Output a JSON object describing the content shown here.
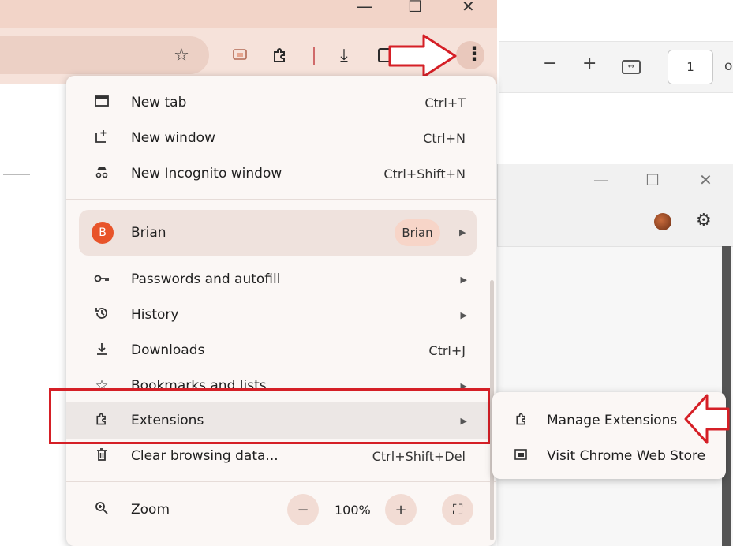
{
  "window": {
    "minimize": "—",
    "maximize": "☐",
    "close": "✕"
  },
  "toolbar": {
    "star": "☆",
    "download": "⤓",
    "menu_dots": "⋮"
  },
  "pdf": {
    "zoom_out": "−",
    "zoom_in": "+",
    "fit": "↔",
    "page": "1",
    "partial": "o"
  },
  "second_window": {
    "minimize": "—",
    "maximize": "☐",
    "close": "✕",
    "settings": "⚙"
  },
  "menu": {
    "new_tab": {
      "label": "New tab",
      "shortcut": "Ctrl+T"
    },
    "new_window": {
      "label": "New window",
      "shortcut": "Ctrl+N"
    },
    "incognito": {
      "label": "New Incognito window",
      "shortcut": "Ctrl+Shift+N"
    },
    "profile": {
      "initial": "B",
      "name": "Brian",
      "chip": "Brian"
    },
    "passwords": {
      "label": "Passwords and autofill"
    },
    "history": {
      "label": "History"
    },
    "downloads": {
      "label": "Downloads",
      "shortcut": "Ctrl+J"
    },
    "bookmarks": {
      "label": "Bookmarks and lists"
    },
    "extensions": {
      "label": "Extensions"
    },
    "clear": {
      "label": "Clear browsing data...",
      "shortcut": "Ctrl+Shift+Del"
    },
    "zoom": {
      "label": "Zoom",
      "minus": "−",
      "value": "100%",
      "plus": "+",
      "fullscreen": "⛶"
    }
  },
  "submenu": {
    "manage": "Manage Extensions",
    "store": "Visit Chrome Web Store"
  },
  "colors": {
    "annotation": "#d51f26",
    "profile_avatar": "#e8542a",
    "titlebar": "#f2d4c8"
  }
}
